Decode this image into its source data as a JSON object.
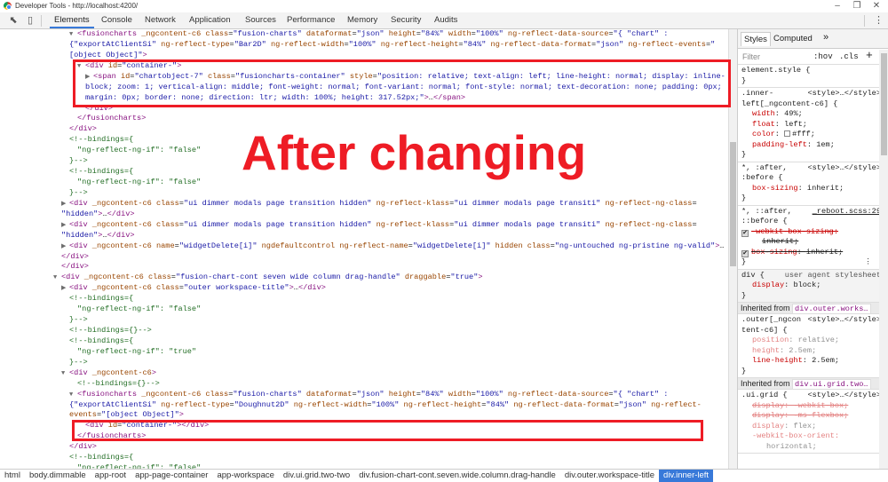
{
  "window": {
    "title": "Developer Tools - http://localhost:4200/",
    "minimize": "–",
    "restore": "❐",
    "close": "✕"
  },
  "toolbar": {
    "tabs": [
      "Elements",
      "Console",
      "Network",
      "Application",
      "Sources",
      "Performance",
      "Memory",
      "Security",
      "Audits"
    ],
    "selected_tab": "Elements",
    "accent": "#3879d9"
  },
  "overlay": {
    "text": "After changing",
    "color": "#ee1c25"
  },
  "elements": {
    "lines": [
      {
        "depth": 2,
        "arrow": "open",
        "src": "t<fusioncharts|a _ngcontent-c6 class|x=|v\"fusion-charts\"|a dataformat|x=|v\"json\"|a height|x=|v\"84%\"|a width|x=|v\"100%\"|a ng-reflect-data-source|x=|v\"{ \"chart\" :"
      },
      {
        "depth": 2,
        "wrap": true,
        "src": "v{\"exportAtClientSi\"|a ng-reflect-type|x=|v\"Bar2D\"|a ng-reflect-width|x=|v\"100%\"|a ng-reflect-height|x=|v\"84%\"|a ng-reflect-data-format|x=|v\"json\"|a ng-reflect-events|x=|v\""
      },
      {
        "depth": 2,
        "wrap": true,
        "src": "v[object Object]\"|t>"
      },
      {
        "depth": 3,
        "arrow": "open",
        "src": "t<div|a id|x=|v\"container-\"|t>"
      },
      {
        "depth": 4,
        "arrow": "closed",
        "src": "t<span|a id|x=|v\"chartobject-7\"|a class|x=|v\"fusioncharts-container\"|a style|x=|v\"position: relative; text-align: left; line-height: normal; display: inline-"
      },
      {
        "depth": 4,
        "wrap": true,
        "src": "vblock; zoom: 1; vertical-align: middle; font-weight: normal; font-variant: normal; font-style: normal; text-decoration: none; padding: 0px;"
      },
      {
        "depth": 4,
        "wrap": true,
        "src": "vmargin: 0px; border: none; direction: ltr; width: 100%; height: 317.52px;\"|t>|x…|t</span>"
      },
      {
        "depth": 3,
        "src": "t</div>"
      },
      {
        "depth": 2,
        "src": "t</fusioncharts>"
      },
      {
        "depth": 1,
        "src": "t</div>"
      },
      {
        "depth": 1,
        "src": "c<!--bindings={"
      },
      {
        "depth": 2,
        "src": "c\"ng-reflect-ng-if\": \"false\""
      },
      {
        "depth": 1,
        "src": "c}-->"
      },
      {
        "depth": 1,
        "src": "c<!--bindings={"
      },
      {
        "depth": 2,
        "src": "c\"ng-reflect-ng-if\": \"false\""
      },
      {
        "depth": 1,
        "src": "c}-->"
      },
      {
        "depth": 1,
        "arrow": "closed",
        "src": "t<div|a _ngcontent-c6 class|x=|v\"ui dimmer modals page transition hidden\"|a ng-reflect-klass|x=|v\"ui dimmer modals page transiti\"|a ng-reflect-ng-class|x="
      },
      {
        "depth": 1,
        "wrap": true,
        "src": "v\"hidden\"|t>|x…|t</div>"
      },
      {
        "depth": 1,
        "arrow": "closed",
        "src": "t<div|a _ngcontent-c6 class|x=|v\"ui dimmer modals page transition hidden\"|a ng-reflect-klass|x=|v\"ui dimmer modals page transiti\"|a ng-reflect-ng-class|x="
      },
      {
        "depth": 1,
        "wrap": true,
        "src": "v\"hidden\"|t>|x…|t</div>"
      },
      {
        "depth": 1,
        "arrow": "closed",
        "src": "t<div|a _ngcontent-c6 name|x=|v\"widgetDelete[i]\"|a ngdefaultcontrol ng-reflect-name|x=|v\"widgetDelete[i]\"|a hidden class|x=|v\"ng-untouched ng-pristine ng-valid\"|t>|x…"
      },
      {
        "depth": 1,
        "wrap": true,
        "src": "t</div>"
      },
      {
        "depth": 0,
        "src": "t</div>"
      },
      {
        "depth": 0,
        "arrow": "open",
        "src": "t<div|a _ngcontent-c6 class|x=|v\"fusion-chart-cont seven wide column drag-handle\"|a draggable|x=|v\"true\"|t>"
      },
      {
        "depth": 1,
        "arrow": "closed",
        "src": "t<div|a _ngcontent-c6 class|x=|v\"outer workspace-title\"|t>|x…|t</div>"
      },
      {
        "depth": 1,
        "src": "c<!--bindings={"
      },
      {
        "depth": 2,
        "src": "c\"ng-reflect-ng-if\": \"false\""
      },
      {
        "depth": 1,
        "src": "c}-->"
      },
      {
        "depth": 1,
        "src": "c<!--bindings={}-->"
      },
      {
        "depth": 1,
        "src": "c<!--bindings={"
      },
      {
        "depth": 2,
        "src": "c\"ng-reflect-ng-if\": \"true\""
      },
      {
        "depth": 1,
        "src": "c}-->"
      },
      {
        "depth": 1,
        "arrow": "open",
        "src": "t<div|a _ngcontent-c6|t>"
      },
      {
        "depth": 2,
        "src": "c<!--bindings={}-->"
      },
      {
        "depth": 2,
        "arrow": "open",
        "src": "t<fusioncharts|a _ngcontent-c6 class|x=|v\"fusion-charts\"|a dataformat|x=|v\"json\"|a height|x=|v\"84%\"|a width|x=|v\"100%\"|a ng-reflect-data-source|x=|v\"{ \"chart\" :"
      },
      {
        "depth": 2,
        "wrap": true,
        "src": "v{\"exportAtClientSi\"|a ng-reflect-type|x=|v\"Doughnut2D\"|a ng-reflect-width|x=|v\"100%\"|a ng-reflect-height|x=|v\"84%\"|a ng-reflect-data-format|x=|v\"json\"|a ng-reflect-"
      },
      {
        "depth": 2,
        "wrap": true,
        "src": "aevents|x=|v\"[object Object]\"|t>"
      },
      {
        "depth": 3,
        "src": "t<div|a id|x=|v\"container-\"|t></div>"
      },
      {
        "depth": 2,
        "src": "t</fusioncharts>"
      },
      {
        "depth": 1,
        "src": "t</div>"
      },
      {
        "depth": 1,
        "src": "c<!--bindings={"
      },
      {
        "depth": 2,
        "src": "c\"ng-reflect-ng-if\": \"false\""
      }
    ]
  },
  "styles": {
    "tabs": [
      "Styles",
      "Computed",
      "»"
    ],
    "filter_placeholder": "Filter",
    "hov": ":hov",
    "cls": ".cls",
    "add": "+",
    "element_style": "element.style {",
    "close_brace": "}",
    "rule1": {
      "sel1": ".inner-",
      "sel2": "left[_ngcontent-c6] {",
      "src": "<style>…</style>",
      "props": [
        {
          "name": "width",
          "value": "49%;"
        },
        {
          "name": "float",
          "value": "left;"
        },
        {
          "name": "color",
          "value": "#fff;"
        },
        {
          "name": "padding-left",
          "value": "1em;"
        }
      ]
    },
    "rule2": {
      "sel1": "*, :after,",
      "sel2": ":before {",
      "src": "<style>…</style>",
      "prop": "box-sizing",
      "value": "inherit;"
    },
    "rule3": {
      "sel1": "*, ::after,",
      "sel2": "::before {",
      "src": "_reboot.scss:29",
      "p1": "-webkit-box-sizing:",
      "p1v": "inherit;",
      "p2": "box-sizing",
      "p2v": "inherit;",
      "check": "✔",
      "more": "⋮"
    },
    "ua": {
      "sel": "div {",
      "src": "user agent stylesheet",
      "prop": "display",
      "value": "block;"
    },
    "inherited1": {
      "label": "Inherited from",
      "node": "div.outer.works…"
    },
    "rule4": {
      "sel1": ".outer[_ngcon",
      "sel2": "tent-c6] {",
      "src": "<style>…</style>",
      "props": [
        {
          "name": "position",
          "value": "relative;"
        },
        {
          "name": "height",
          "value": "2.5em;"
        },
        {
          "name": "line-height",
          "value": "2.5em;"
        }
      ]
    },
    "inherited2": {
      "label": "Inherited from",
      "node": "div.ui.grid.two…"
    },
    "rule5": {
      "sel": ".ui.grid {",
      "src": "<style>…</style>",
      "l1": "display: -webkit-box;",
      "l2": "display: -ms-flexbox;",
      "l3n": "display",
      "l3v": "flex;",
      "l4": "-webkit-box-orient:",
      "l5": "horizontal;"
    }
  },
  "breadcrumbs": {
    "items": [
      "html",
      "body.dimmable",
      "app-root",
      "app-page-container",
      "app-workspace",
      "div.ui.grid.two-two",
      "div.fusion-chart-cont.seven.wide.column.drag-handle",
      "div.outer.workspace-title",
      "div.inner-left"
    ],
    "selected": "div.inner-left"
  }
}
